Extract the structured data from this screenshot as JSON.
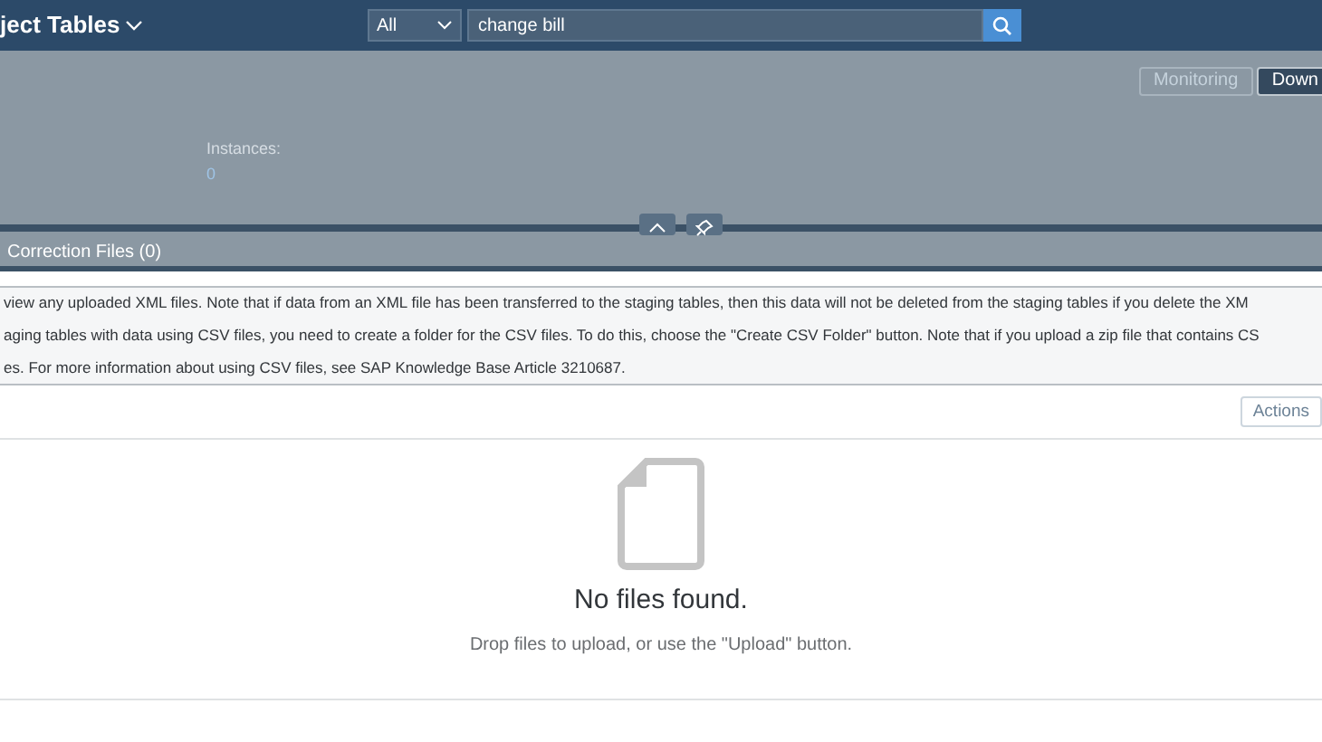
{
  "shell": {
    "title": "ject Tables",
    "search": {
      "scope": "All",
      "value": "change bill"
    }
  },
  "header": {
    "buttons": [
      {
        "label": "Monitoring",
        "kind": "ghost"
      },
      {
        "label": "Down",
        "kind": "emphasized"
      }
    ],
    "attribute": {
      "label": "Instances:",
      "value": "0"
    }
  },
  "tabs": [
    {
      "label": "Correction Files (0)",
      "selected": true
    }
  ],
  "message": {
    "paragraphs": [
      "view any uploaded XML files. Note that if data from an XML file has been transferred to the staging tables, then this data will not be deleted from the staging tables if you delete the XM",
      "aging tables with data using CSV files, you need to create a folder for the CSV files. To do this, choose the \"Create CSV Folder\" button. Note that if you upload a zip file that contains CS",
      "es. For more information about using CSV files, see SAP Knowledge Base Article 3210687."
    ]
  },
  "toolbar": {
    "buttons": [
      {
        "label": "Actions",
        "disabled": true
      }
    ]
  },
  "empty_state": {
    "title": "No files found.",
    "description": "Drop files to upload, or use the \"Upload\" button."
  }
}
